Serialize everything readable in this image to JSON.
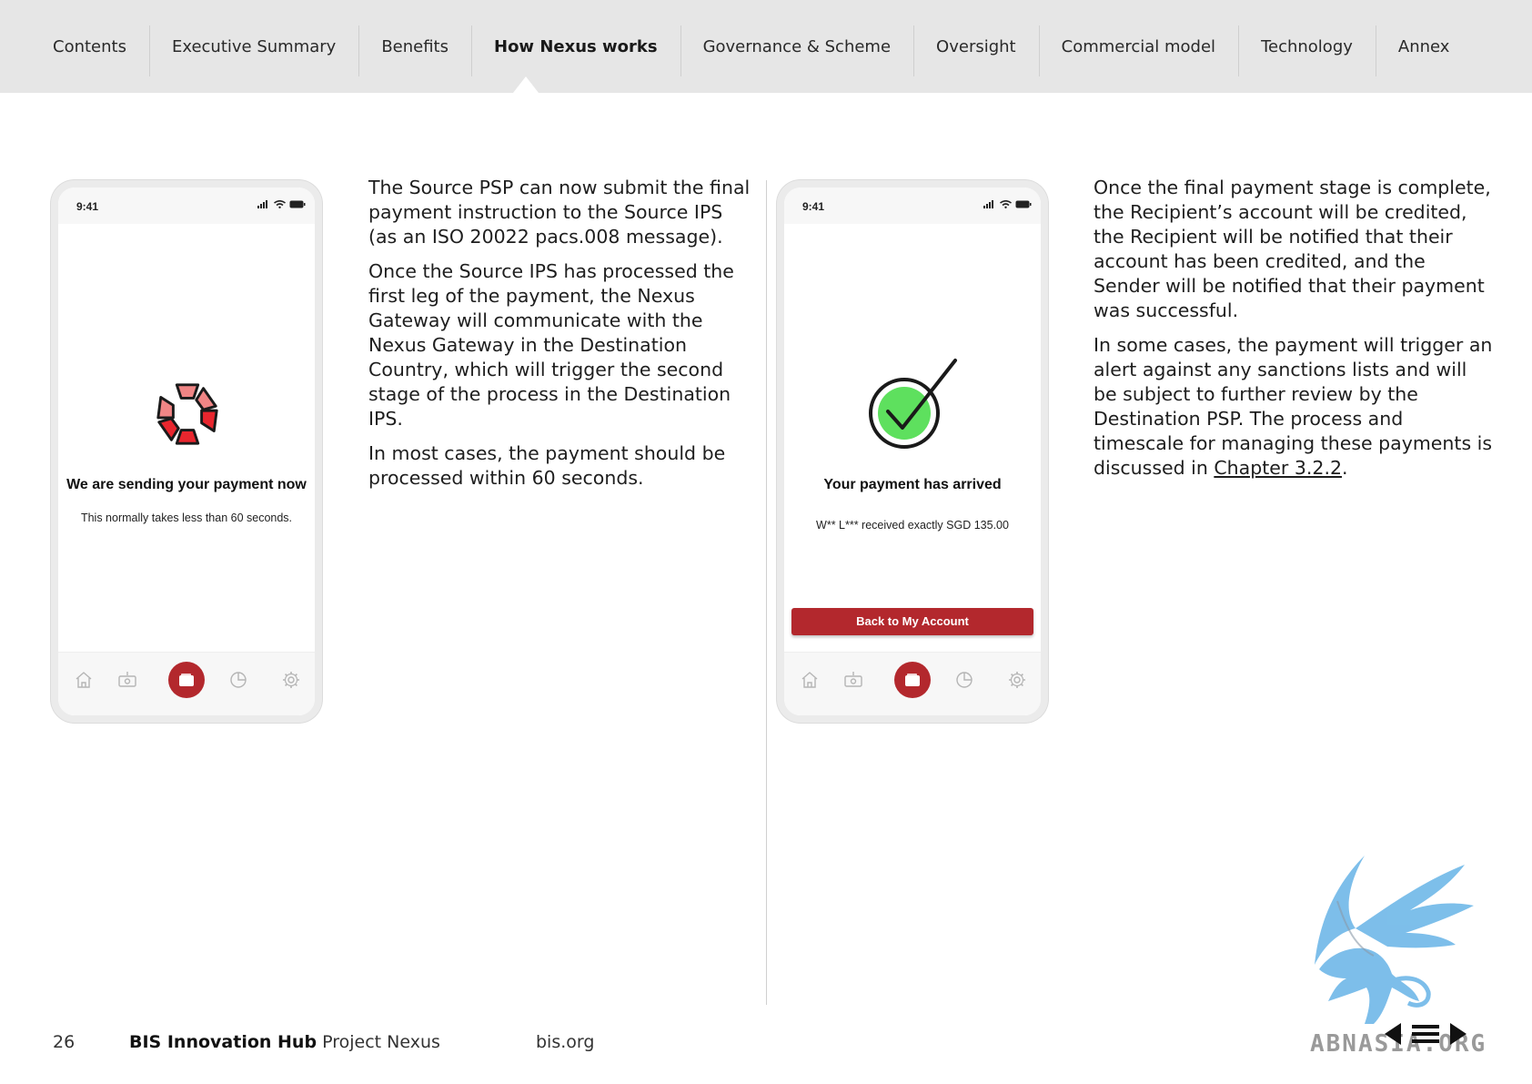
{
  "nav": {
    "items": [
      {
        "label": "Contents"
      },
      {
        "label": "Executive Summary"
      },
      {
        "label": "Benefits"
      },
      {
        "label": "How Nexus works"
      },
      {
        "label": "Governance & Scheme"
      },
      {
        "label": "Oversight"
      },
      {
        "label": "Commercial model"
      },
      {
        "label": "Technology"
      },
      {
        "label": "Annex"
      }
    ],
    "active_index": 3
  },
  "phone1": {
    "time": "9:41",
    "title": "We are sending your payment now",
    "subtitle": "This normally takes less than 60 seconds."
  },
  "col1": {
    "p1": "The Source PSP can now submit the final payment instruction to the Source IPS (as an ISO 20022 pacs.008 message).",
    "p2": "Once the Source IPS has processed the first leg of the payment, the Nexus Gateway will communicate with the Nexus Gateway in the Destination Country, which will trigger the second stage of the process in the Destination IPS.",
    "p3": "In most cases, the payment should be processed within 60 seconds."
  },
  "phone2": {
    "time": "9:41",
    "title": "Your payment has arrived",
    "subtitle": "W** L*** received exactly SGD 135.00",
    "button": "Back to My Account"
  },
  "col2": {
    "p1": "Once the final payment stage is complete, the Recipient’s account will be credited, the Recipient will be notified that their account has been credited, and the Sender will be notified that their payment was successful.",
    "p2": "In some cases, the payment will trigger an alert against any sanctions lists and will be subject to further review by the Destination PSP. The process and timescale for managing these payments is discussed in ",
    "link": "Chapter 3.2.2",
    "after_link": "."
  },
  "footer": {
    "page_number": "26",
    "org": "BIS Innovation Hub",
    "project": "Project Nexus",
    "site": "bis.org"
  },
  "watermark": {
    "text": "ABNASIA.ORG"
  },
  "colors": {
    "accent": "#b3282d",
    "nav_bg": "#e6e6e6",
    "success_green": "#5ee05e",
    "spinner_red": "#e8262e",
    "spinner_pink": "#f08585"
  }
}
